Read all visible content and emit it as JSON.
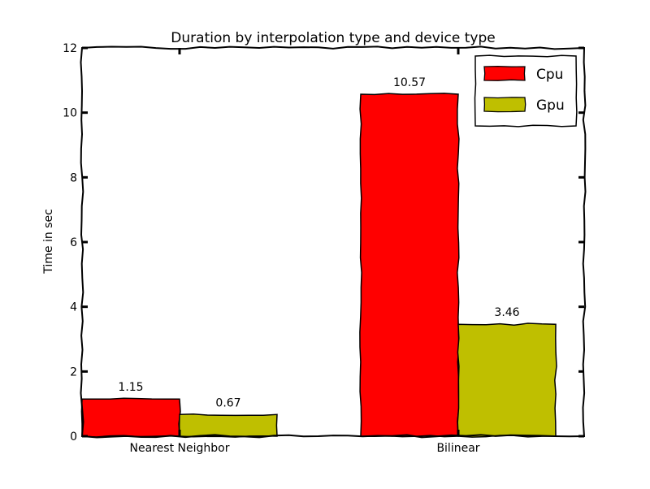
{
  "chart_data": {
    "type": "bar",
    "title": "Duration by interpolation type and device type",
    "xlabel": "",
    "ylabel": "Time in sec",
    "categories": [
      "Nearest Neighbor",
      "Bilinear"
    ],
    "series": [
      {
        "name": "Cpu",
        "color": "#ff0000",
        "values": [
          1.15,
          10.57
        ]
      },
      {
        "name": "Gpu",
        "color": "#bfbf00",
        "values": [
          0.67,
          3.46
        ]
      }
    ],
    "ylim": [
      0,
      12
    ],
    "yticks": [
      0,
      2,
      4,
      6,
      8,
      10,
      12
    ],
    "value_labels": [
      [
        "1.15",
        "10.57"
      ],
      [
        "0.67",
        "3.46"
      ]
    ],
    "grid": false,
    "legend_position": "top-right",
    "style": "xkcd"
  }
}
